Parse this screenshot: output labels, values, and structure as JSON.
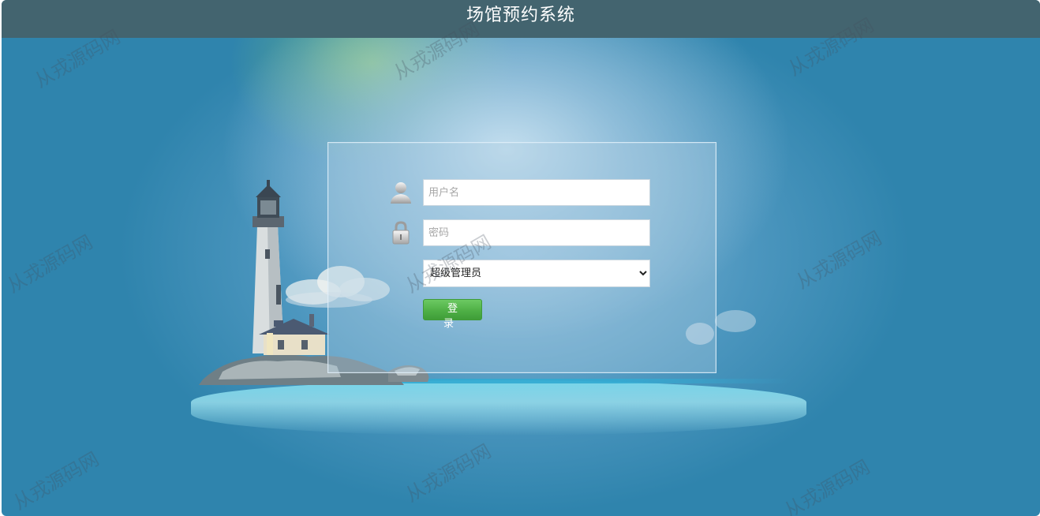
{
  "header": {
    "title": "场馆预约系统"
  },
  "login_form": {
    "username_placeholder": "用户名",
    "password_placeholder": "密码",
    "role_options": [
      "超级管理员"
    ],
    "role_selected": "超级管理员",
    "submit_label": "登　录"
  },
  "watermark_text": "从戎源码网",
  "icons": {
    "username": "user-icon",
    "password": "lock-icon",
    "select": "chevron-down-icon"
  },
  "colors": {
    "header_bg": "#43646f",
    "page_bg": "#2f84ad",
    "button_green": "#4fb046"
  }
}
